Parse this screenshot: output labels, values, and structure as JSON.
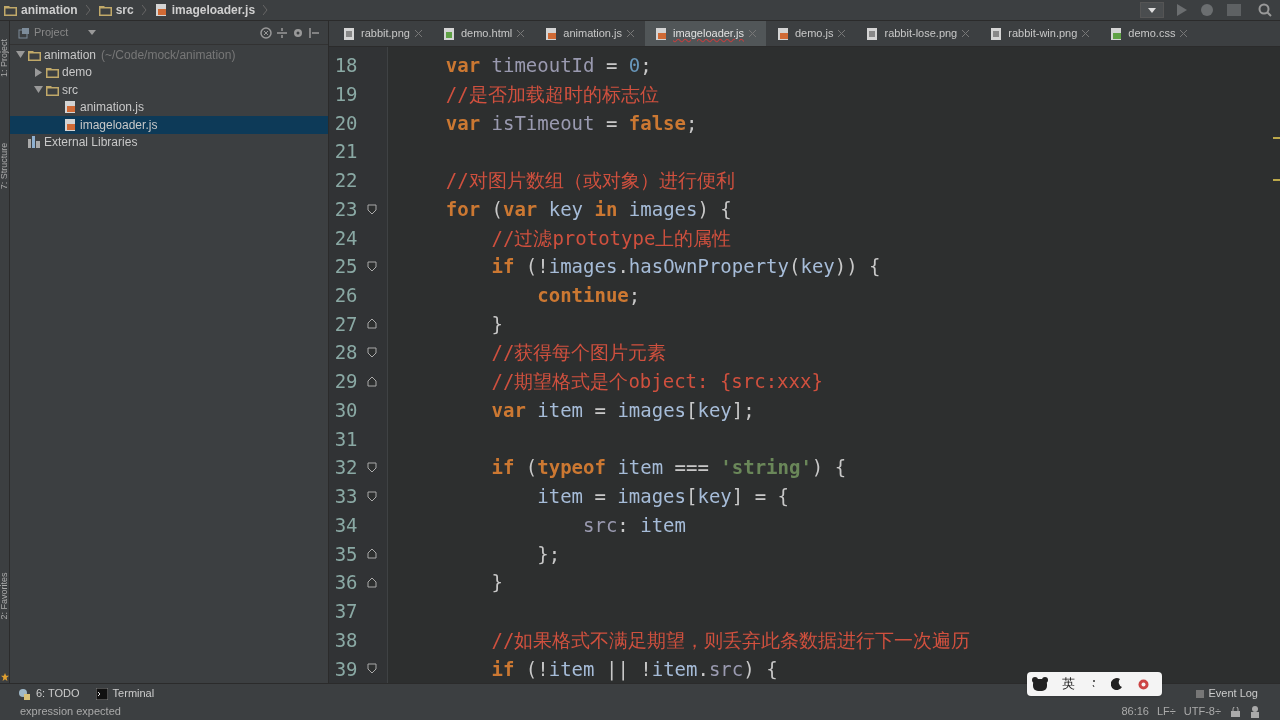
{
  "breadcrumb": [
    {
      "label": "animation",
      "kind": "folder"
    },
    {
      "label": "src",
      "kind": "folder"
    },
    {
      "label": "imageloader.js",
      "kind": "js"
    }
  ],
  "tool_strip": {
    "top": [
      "1: Project",
      "7: Structure"
    ],
    "bottom": [
      "2: Favorites"
    ]
  },
  "project_panel": {
    "title": "Project",
    "tree": [
      {
        "label": "animation",
        "path": "(~/Code/mock/animation)",
        "kind": "folder",
        "expanded": true,
        "selected": false,
        "children": [
          {
            "label": "demo",
            "kind": "folder",
            "expanded": false,
            "selected": false
          },
          {
            "label": "src",
            "kind": "folder",
            "expanded": true,
            "selected": false,
            "children": [
              {
                "label": "animation.js",
                "kind": "js",
                "selected": false
              },
              {
                "label": "imageloader.js",
                "kind": "js",
                "selected": true
              }
            ]
          }
        ]
      },
      {
        "label": "External Libraries",
        "kind": "library",
        "selected": false
      }
    ]
  },
  "tabs": [
    {
      "label": "rabbit.png",
      "kind": "image",
      "selected": false
    },
    {
      "label": "demo.html",
      "kind": "html",
      "selected": false
    },
    {
      "label": "animation.js",
      "kind": "js",
      "selected": false
    },
    {
      "label": "imageloader.js",
      "kind": "js",
      "selected": true
    },
    {
      "label": "demo.js",
      "kind": "js",
      "selected": false
    },
    {
      "label": "rabbit-lose.png",
      "kind": "image",
      "selected": false
    },
    {
      "label": "rabbit-win.png",
      "kind": "image",
      "selected": false
    },
    {
      "label": "demo.css",
      "kind": "css",
      "selected": false
    }
  ],
  "editor": {
    "lines": [
      {
        "number": "18",
        "tokens": [
          {
            "kind": "keyword",
            "text": "    var "
          },
          {
            "kind": "field",
            "text": "timeoutId"
          },
          {
            "kind": "text",
            "text": " = "
          },
          {
            "kind": "number",
            "text": "0"
          },
          {
            "kind": "text",
            "text": ";"
          }
        ]
      },
      {
        "number": "19",
        "tokens": [
          {
            "kind": "comment",
            "text": "    //是否加载超时的标志位"
          }
        ]
      },
      {
        "number": "20",
        "tokens": [
          {
            "kind": "keyword",
            "text": "    var "
          },
          {
            "kind": "field",
            "text": "isTimeout"
          },
          {
            "kind": "text",
            "text": " = "
          },
          {
            "kind": "keyword",
            "text": "false"
          },
          {
            "kind": "text",
            "text": ";"
          }
        ]
      },
      {
        "number": "21"
      },
      {
        "number": "22",
        "tokens": [
          {
            "kind": "comment",
            "text": "    //对图片数组（或对象）进行便利"
          }
        ]
      },
      {
        "number": "23",
        "fold_open": true,
        "tokens": [
          {
            "kind": "keyword",
            "text": "    for "
          },
          {
            "kind": "text",
            "text": "("
          },
          {
            "kind": "keyword",
            "text": "var "
          },
          {
            "kind": "name",
            "text": "key"
          },
          {
            "kind": "keyword",
            "text": " in "
          },
          {
            "kind": "name",
            "text": "images"
          },
          {
            "kind": "text",
            "text": ") {"
          }
        ]
      },
      {
        "number": "24",
        "tokens": [
          {
            "kind": "comment",
            "text": "        //过滤prototype上的属性"
          }
        ]
      },
      {
        "number": "25",
        "fold_open": true,
        "tokens": [
          {
            "kind": "keyword",
            "text": "        if "
          },
          {
            "kind": "text",
            "text": "(!"
          },
          {
            "kind": "name",
            "text": "images"
          },
          {
            "kind": "text",
            "text": "."
          },
          {
            "kind": "name",
            "text": "hasOwnProperty"
          },
          {
            "kind": "text",
            "text": "("
          },
          {
            "kind": "name",
            "text": "key"
          },
          {
            "kind": "text",
            "text": ")) {"
          }
        ]
      },
      {
        "number": "26",
        "tokens": [
          {
            "kind": "keyword",
            "text": "            continue"
          },
          {
            "kind": "text",
            "text": ";"
          }
        ]
      },
      {
        "number": "27",
        "fold_close": true,
        "tokens": [
          {
            "kind": "text",
            "text": "        }"
          }
        ]
      },
      {
        "number": "28",
        "fold_open": true,
        "tokens": [
          {
            "kind": "comment",
            "text": "        //获得每个图片元素"
          }
        ]
      },
      {
        "number": "29",
        "fold_close": true,
        "tokens": [
          {
            "kind": "comment",
            "text": "        //期望格式是个object: {src:xxx}"
          }
        ]
      },
      {
        "number": "30",
        "tokens": [
          {
            "kind": "keyword",
            "text": "        var "
          },
          {
            "kind": "name",
            "text": "item"
          },
          {
            "kind": "text",
            "text": " = "
          },
          {
            "kind": "name",
            "text": "images"
          },
          {
            "kind": "text",
            "text": "["
          },
          {
            "kind": "name",
            "text": "key"
          },
          {
            "kind": "text",
            "text": "];"
          }
        ]
      },
      {
        "number": "31"
      },
      {
        "number": "32",
        "fold_open": true,
        "tokens": [
          {
            "kind": "keyword",
            "text": "        if "
          },
          {
            "kind": "text",
            "text": "("
          },
          {
            "kind": "keyword",
            "text": "typeof "
          },
          {
            "kind": "name",
            "text": "item"
          },
          {
            "kind": "text",
            "text": " === "
          },
          {
            "kind": "string",
            "text": "'string'"
          },
          {
            "kind": "text",
            "text": ") {"
          }
        ]
      },
      {
        "number": "33",
        "fold_open": true,
        "tokens": [
          {
            "kind": "name",
            "text": "            item"
          },
          {
            "kind": "text",
            "text": " = "
          },
          {
            "kind": "name",
            "text": "images"
          },
          {
            "kind": "text",
            "text": "["
          },
          {
            "kind": "name",
            "text": "key"
          },
          {
            "kind": "text",
            "text": "] = {"
          }
        ]
      },
      {
        "number": "34",
        "tokens": [
          {
            "kind": "field",
            "text": "                src"
          },
          {
            "kind": "text",
            "text": ": "
          },
          {
            "kind": "name",
            "text": "item"
          }
        ]
      },
      {
        "number": "35",
        "fold_close": true,
        "tokens": [
          {
            "kind": "text",
            "text": "            };"
          }
        ]
      },
      {
        "number": "36",
        "fold_close": true,
        "tokens": [
          {
            "kind": "text",
            "text": "        }"
          }
        ]
      },
      {
        "number": "37"
      },
      {
        "number": "38",
        "tokens": [
          {
            "kind": "comment",
            "text": "        //如果格式不满足期望，则丢弃此条数据进行下一次遍历"
          }
        ]
      },
      {
        "number": "39",
        "fold_open": true,
        "tokens": [
          {
            "kind": "keyword",
            "text": "        if "
          },
          {
            "kind": "text",
            "text": "(!"
          },
          {
            "kind": "name",
            "text": "item"
          },
          {
            "kind": "text",
            "text": " || !"
          },
          {
            "kind": "name",
            "text": "item"
          },
          {
            "kind": "text",
            "text": "."
          },
          {
            "kind": "field",
            "text": "src"
          },
          {
            "kind": "text",
            "text": ") {"
          }
        ]
      }
    ]
  },
  "tool_windows": [
    {
      "label": "6: TODO",
      "kind": "todo"
    },
    {
      "label": "Terminal",
      "kind": "terminal"
    }
  ],
  "ime_toolbar": {
    "label": "英"
  },
  "status_bar": {
    "message": "expression expected",
    "event_log": "Event Log",
    "position": "86:16",
    "line_separator": "LF÷",
    "encoding": "UTF-8÷"
  }
}
